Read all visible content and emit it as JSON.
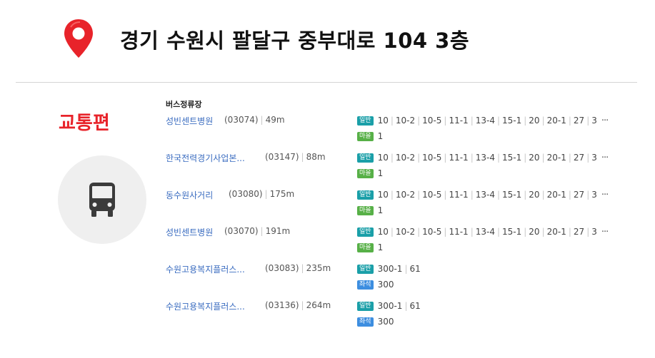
{
  "header": {
    "address": "경기 수원시 팔달구 중부대로 104 3층"
  },
  "section": {
    "title": "교통편",
    "stops_heading": "버스정류장"
  },
  "stops": [
    {
      "name": "성빈센트병원",
      "code": "(03074)",
      "distance": "49m",
      "lines": [
        {
          "type": "일반",
          "kind": "general",
          "routes": [
            "10",
            "10-2",
            "10-5",
            "11-1",
            "13-4",
            "15-1",
            "20",
            "20-1",
            "27",
            "3"
          ],
          "more": "···"
        },
        {
          "type": "마을",
          "kind": "village",
          "routes": [
            "1"
          ],
          "more": ""
        }
      ]
    },
    {
      "name": "한국전력경기사업본...",
      "code": "(03147)",
      "distance": "88m",
      "lines": [
        {
          "type": "일반",
          "kind": "general",
          "routes": [
            "10",
            "10-2",
            "10-5",
            "11-1",
            "13-4",
            "15-1",
            "20",
            "20-1",
            "27",
            "3"
          ],
          "more": "···"
        },
        {
          "type": "마을",
          "kind": "village",
          "routes": [
            "1"
          ],
          "more": ""
        }
      ]
    },
    {
      "name": "동수원사거리",
      "code": "(03080)",
      "distance": "175m",
      "lines": [
        {
          "type": "일반",
          "kind": "general",
          "routes": [
            "10",
            "10-2",
            "10-5",
            "11-1",
            "13-4",
            "15-1",
            "20",
            "20-1",
            "27",
            "3"
          ],
          "more": "···"
        },
        {
          "type": "마을",
          "kind": "village",
          "routes": [
            "1"
          ],
          "more": ""
        }
      ]
    },
    {
      "name": "성빈센트병원",
      "code": "(03070)",
      "distance": "191m",
      "lines": [
        {
          "type": "일반",
          "kind": "general",
          "routes": [
            "10",
            "10-2",
            "10-5",
            "11-1",
            "13-4",
            "15-1",
            "20",
            "20-1",
            "27",
            "3"
          ],
          "more": "···"
        },
        {
          "type": "마을",
          "kind": "village",
          "routes": [
            "1"
          ],
          "more": ""
        }
      ]
    },
    {
      "name": "수원고용복지플러스...",
      "code": "(03083)",
      "distance": "235m",
      "lines": [
        {
          "type": "일반",
          "kind": "general",
          "routes": [
            "300-1",
            "61"
          ],
          "more": ""
        },
        {
          "type": "좌석",
          "kind": "seat",
          "routes": [
            "300"
          ],
          "more": ""
        }
      ]
    },
    {
      "name": "수원고용복지플러스...",
      "code": "(03136)",
      "distance": "264m",
      "lines": [
        {
          "type": "일반",
          "kind": "general",
          "routes": [
            "300-1",
            "61"
          ],
          "more": ""
        },
        {
          "type": "좌석",
          "kind": "seat",
          "routes": [
            "300"
          ],
          "more": ""
        }
      ]
    }
  ],
  "colors": {
    "pin": "#e8232a",
    "title": "#e8232a",
    "link": "#3a6cc0",
    "general": "#1a9fa8",
    "village": "#57b047",
    "seat": "#3d8ee0"
  },
  "icons": {
    "location": "map-pin-icon",
    "transport": "bus-icon",
    "more": "more-icon"
  }
}
